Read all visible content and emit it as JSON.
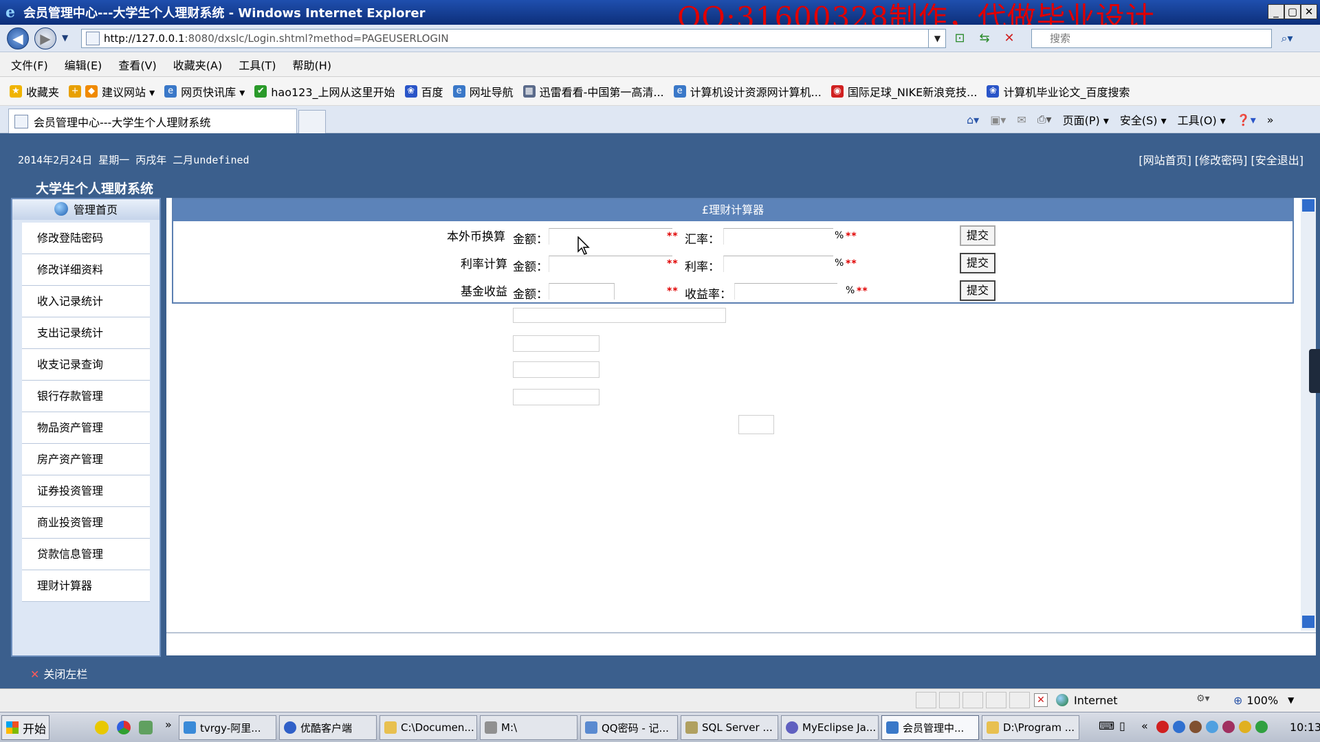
{
  "window": {
    "title": "会员管理中心---大学生个人理财系统 - Windows Internet Explorer",
    "watermark": "QQ:31600328制作，代做毕业设计"
  },
  "address": {
    "url_host": "http://127.0.0.1",
    "url_rest": ":8080/dxslc/Login.shtml?method=PAGEUSERLOGIN",
    "search_placeholder": "搜索"
  },
  "menu": [
    "文件(F)",
    "编辑(E)",
    "查看(V)",
    "收藏夹(A)",
    "工具(T)",
    "帮助(H)"
  ],
  "favorites": {
    "label": "收藏夹",
    "items": [
      "建议网站 ▾",
      "网页快讯库 ▾",
      "hao123_上网从这里开始",
      "百度",
      "网址导航",
      "迅雷看看-中国第一高清...",
      "计算机设计资源网计算机...",
      "国际足球_NIKE新浪竞技...",
      "计算机毕业论文_百度搜索"
    ]
  },
  "tab": {
    "title": "会员管理中心---大学生个人理财系统"
  },
  "command_bar": [
    "页面(P) ▾",
    "安全(S) ▾",
    "工具(O) ▾"
  ],
  "header": {
    "date": "2014年2月24日 星期一 丙戌年 二月undefined",
    "links": "[网站首页] [修改密码] [安全退出]",
    "system_name": "大学生个人理财系统"
  },
  "sidebar": {
    "title": "管理首页",
    "items": [
      "修改登陆密码",
      "修改详细资料",
      "收入记录统计",
      "支出记录统计",
      "收支记录查询",
      "银行存款管理",
      "物品资产管理",
      "房产资产管理",
      "证券投资管理",
      "商业投资管理",
      "贷款信息管理",
      "理财计算器"
    ]
  },
  "calculator": {
    "title": "£理财计算器",
    "required_mark": "**",
    "submit": "提交",
    "rows": [
      {
        "label": "本外币换算",
        "field1": "金额：",
        "field2": "汇率：",
        "unit": "%"
      },
      {
        "label": "利率计算",
        "field1": "金额：",
        "field2": "利率：",
        "unit": "%"
      },
      {
        "label": "基金收益",
        "field1": "金额：",
        "field2": "收益率：",
        "unit": "%"
      }
    ]
  },
  "footer": {
    "close_sidebar": "关闭左栏"
  },
  "statusbar": {
    "zone": "Internet",
    "zoom": "100%"
  },
  "taskbar": {
    "start": "开始",
    "tasks": [
      "tvrgy-阿里...",
      "优酷客户端",
      "C:\\Documen...",
      "M:\\",
      "QQ密码 - 记...",
      "SQL Server ...",
      "MyEclipse Ja...",
      "会员管理中...",
      "D:\\Program ..."
    ],
    "clock": "10:13"
  },
  "colors": {
    "header_blue": "#3b5f8d",
    "form_head": "#5c83b9",
    "required_red": "#e00000"
  }
}
